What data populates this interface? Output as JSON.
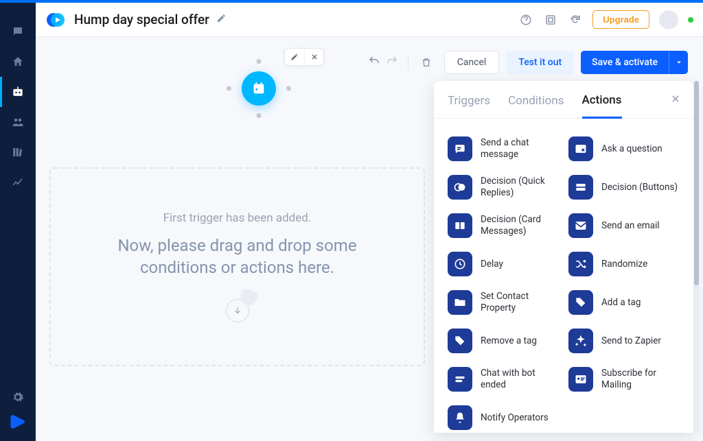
{
  "header": {
    "title": "Hump day special offer",
    "upgrade_label": "Upgrade"
  },
  "toolbar": {
    "cancel_label": "Cancel",
    "test_label": "Test it out",
    "save_label": "Save & activate"
  },
  "dropzone": {
    "small": "First trigger has been added.",
    "big": "Now, please drag and drop some conditions or actions here."
  },
  "panel": {
    "tabs": {
      "triggers": "Triggers",
      "conditions": "Conditions",
      "actions": "Actions"
    },
    "actions_left": [
      {
        "label": "Send a chat message",
        "icon": "chat"
      },
      {
        "label": "Decision (Quick Replies)",
        "icon": "quick"
      },
      {
        "label": "Decision (Card Messages)",
        "icon": "cards"
      },
      {
        "label": "Delay",
        "icon": "clock"
      },
      {
        "label": "Set Contact Property",
        "icon": "folder"
      },
      {
        "label": "Remove a tag",
        "icon": "tag"
      },
      {
        "label": "Chat with bot ended",
        "icon": "botend"
      },
      {
        "label": "Notify Operators",
        "icon": "bell"
      }
    ],
    "actions_right": [
      {
        "label": "Ask a question",
        "icon": "question"
      },
      {
        "label": "Decision (Buttons)",
        "icon": "buttons"
      },
      {
        "label": "Send an email",
        "icon": "email"
      },
      {
        "label": "Randomize",
        "icon": "shuffle"
      },
      {
        "label": "Add a tag",
        "icon": "tag"
      },
      {
        "label": "Send to Zapier",
        "icon": "zap"
      },
      {
        "label": "Subscribe for Mailing",
        "icon": "subscribe"
      }
    ]
  },
  "colors": {
    "accent": "#0b5fff",
    "node": "#00b8ff",
    "action_icon_bg": "#1e3b98",
    "upgrade": "#f59b23"
  }
}
